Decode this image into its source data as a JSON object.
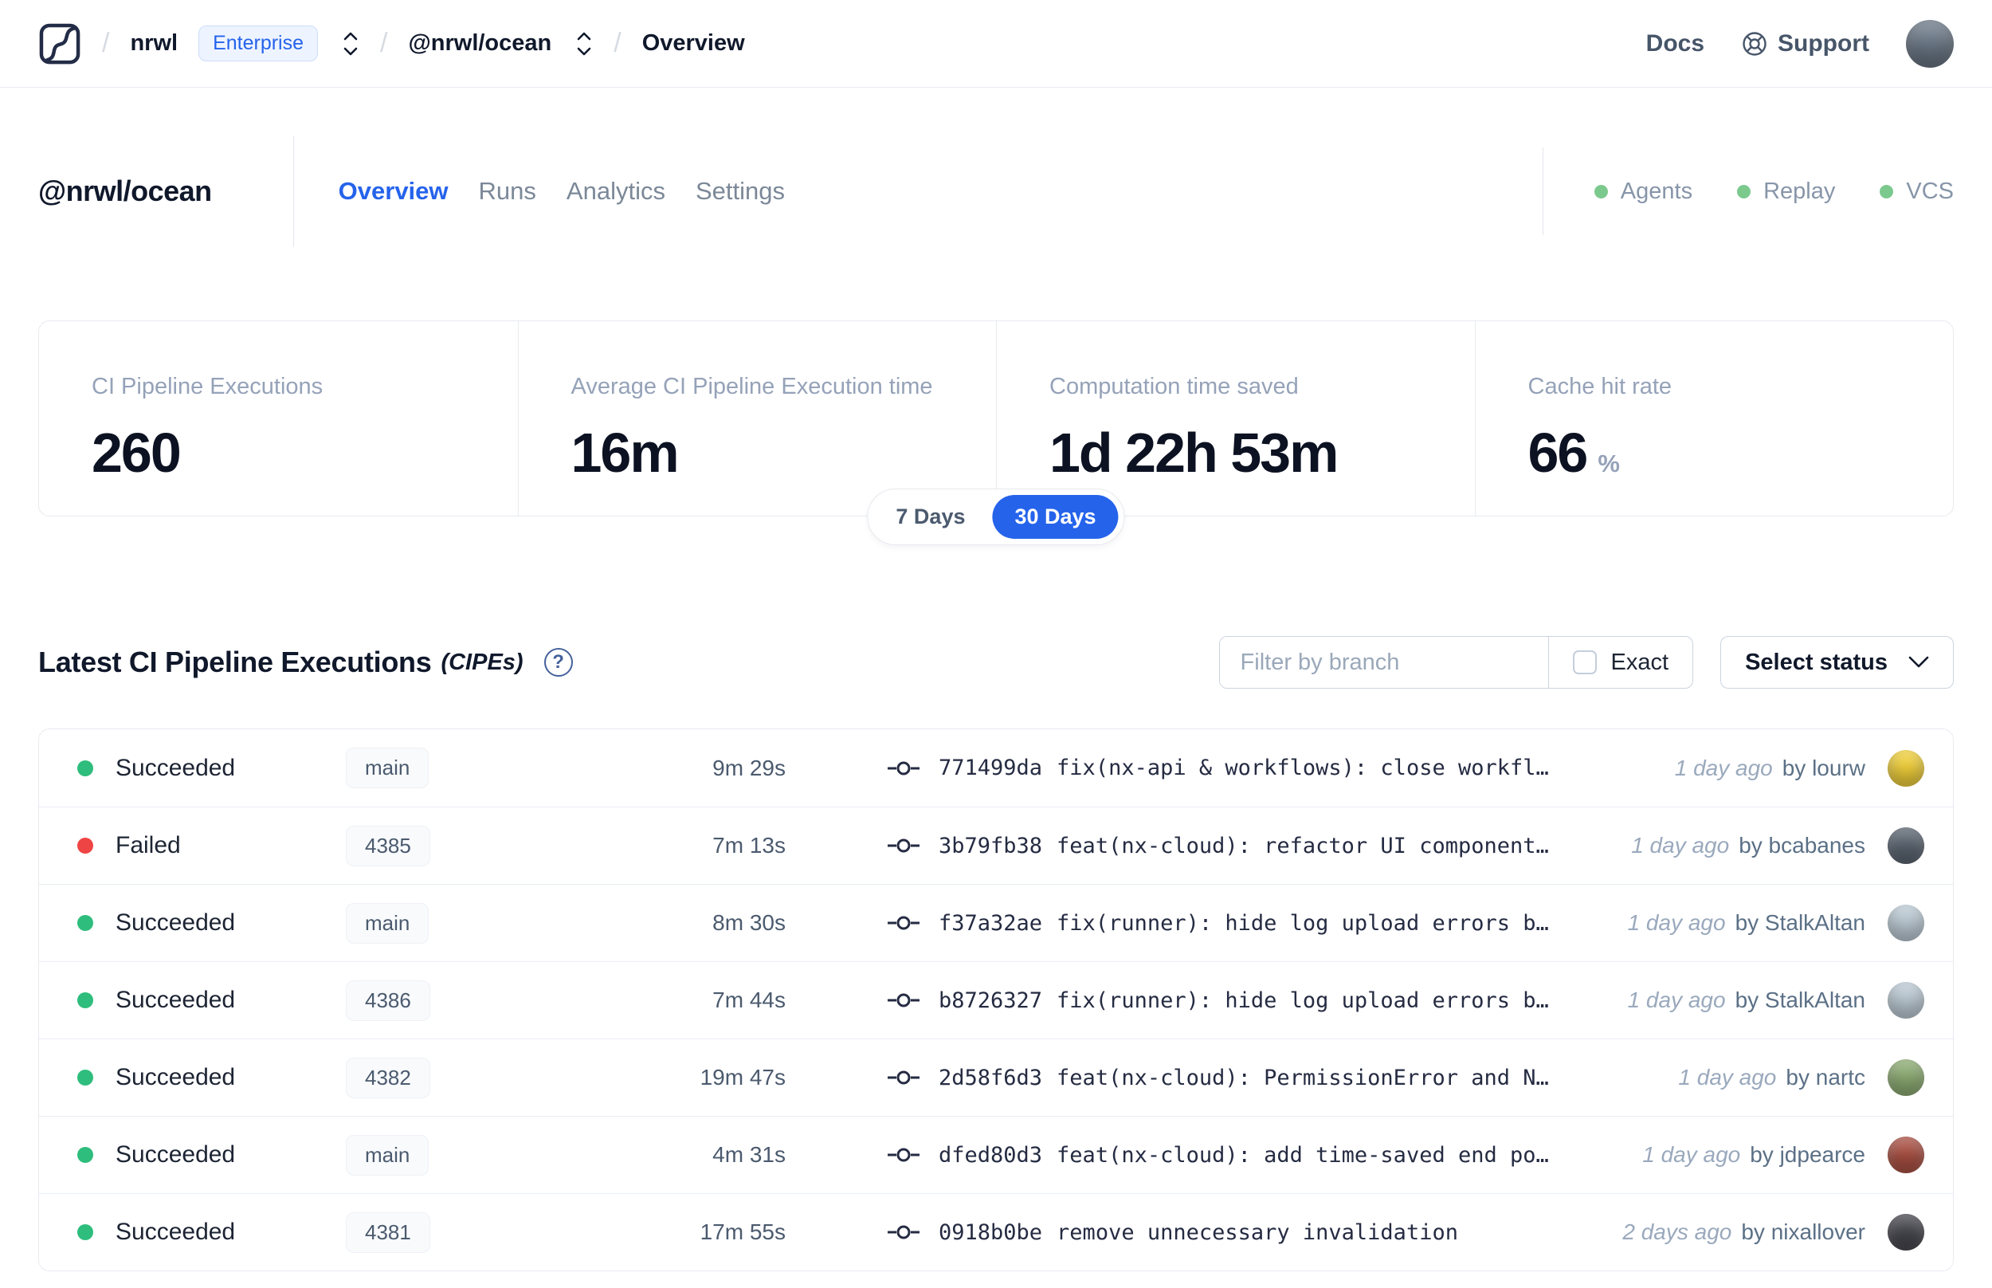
{
  "navbar": {
    "separator": "/",
    "org": "nrwl",
    "org_badge": "Enterprise",
    "workspace": "@nrwl/ocean",
    "page": "Overview",
    "docs_label": "Docs",
    "support_label": "Support",
    "avatar_color": "#6e7b8a"
  },
  "header": {
    "title": "@nrwl/ocean",
    "tabs": [
      {
        "label": "Overview",
        "active": true
      },
      {
        "label": "Runs",
        "active": false
      },
      {
        "label": "Analytics",
        "active": false
      },
      {
        "label": "Settings",
        "active": false
      }
    ],
    "statuses": [
      {
        "label": "Agents",
        "color": "#7cc98e"
      },
      {
        "label": "Replay",
        "color": "#7cc98e"
      },
      {
        "label": "VCS",
        "color": "#7cc98e"
      }
    ]
  },
  "stats": {
    "cards": [
      {
        "label": "CI Pipeline Executions",
        "value": "260",
        "unit": ""
      },
      {
        "label": "Average CI Pipeline Execution time",
        "value": "16m",
        "unit": ""
      },
      {
        "label": "Computation time saved",
        "value": "1d 22h 53m",
        "unit": ""
      },
      {
        "label": "Cache hit rate",
        "value": "66",
        "unit": "%"
      }
    ],
    "toggle": {
      "options": [
        {
          "label": "7 Days",
          "active": false
        },
        {
          "label": "30 Days",
          "active": true
        }
      ]
    }
  },
  "cipes": {
    "title": "Latest CI Pipeline Executions",
    "title_suffix": "(CIPEs)",
    "help_glyph": "?",
    "filter": {
      "placeholder": "Filter by branch",
      "exact_label": "Exact",
      "exact_checked": false,
      "status_button": "Select status"
    },
    "rows": [
      {
        "status": "Succeeded",
        "status_color": "#2ebd7c",
        "branch": "main",
        "duration": "9m 29s",
        "commit_hash": "771499da",
        "commit_message": "fix(nx-api & workflows): close workfl…",
        "time_ago": "1 day ago",
        "author": "by lourw",
        "avatar_color": "#f0cf3a"
      },
      {
        "status": "Failed",
        "status_color": "#ef4444",
        "branch": "4385",
        "duration": "7m 13s",
        "commit_hash": "3b79fb38",
        "commit_message": "feat(nx-cloud): refactor UI component…",
        "time_ago": "1 day ago",
        "author": "by bcabanes",
        "avatar_color": "#5a6470"
      },
      {
        "status": "Succeeded",
        "status_color": "#2ebd7c",
        "branch": "main",
        "duration": "8m 30s",
        "commit_hash": "f37a32ae",
        "commit_message": "fix(runner): hide log upload errors b…",
        "time_ago": "1 day ago",
        "author": "by StalkAltan",
        "avatar_color": "#bccad4"
      },
      {
        "status": "Succeeded",
        "status_color": "#2ebd7c",
        "branch": "4386",
        "duration": "7m 44s",
        "commit_hash": "b8726327",
        "commit_message": "fix(runner): hide log upload errors b…",
        "time_ago": "1 day ago",
        "author": "by StalkAltan",
        "avatar_color": "#bccad4"
      },
      {
        "status": "Succeeded",
        "status_color": "#2ebd7c",
        "branch": "4382",
        "duration": "19m 47s",
        "commit_hash": "2d58f6d3",
        "commit_message": "feat(nx-cloud): PermissionError and N…",
        "time_ago": "1 day ago",
        "author": "by nartc",
        "avatar_color": "#8cab72"
      },
      {
        "status": "Succeeded",
        "status_color": "#2ebd7c",
        "branch": "main",
        "duration": "4m 31s",
        "commit_hash": "dfed80d3",
        "commit_message": "feat(nx-cloud): add time-saved end po…",
        "time_ago": "1 day ago",
        "author": "by jdpearce",
        "avatar_color": "#a94f42"
      },
      {
        "status": "Succeeded",
        "status_color": "#2ebd7c",
        "branch": "4381",
        "duration": "17m 55s",
        "commit_hash": "0918b0be",
        "commit_message": "remove unnecessary invalidation",
        "time_ago": "2 days ago",
        "author": "by nixallover",
        "avatar_color": "#46464e"
      }
    ]
  }
}
